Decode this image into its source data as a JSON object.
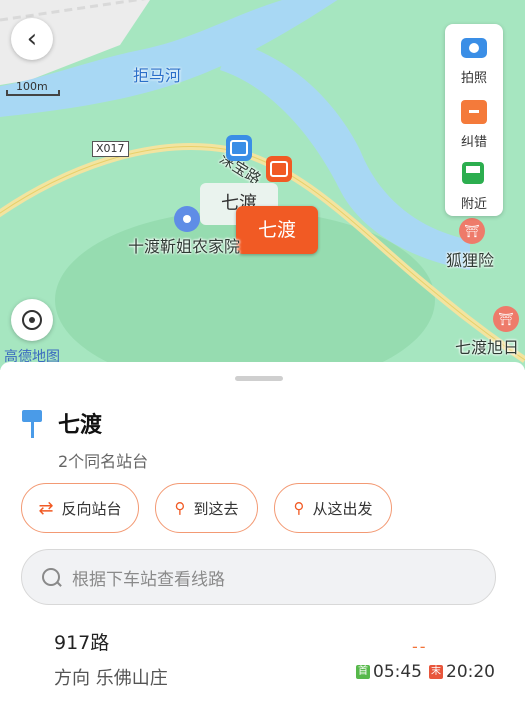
{
  "map": {
    "river_label": "拒马河",
    "scale_label": "100m",
    "road_code": "X017",
    "road_name": "涞宝路",
    "gray_bubble": "七渡",
    "orange_bubble": "七渡",
    "poi_farmhouse": "十渡靳姐农家院",
    "poi_fox": "狐狸险",
    "poi_qidu": "七渡旭日",
    "logo": "高德地图",
    "tools": [
      {
        "label": "拍照",
        "icon": "camera-icon"
      },
      {
        "label": "纠错",
        "icon": "report-error-icon"
      },
      {
        "label": "附近",
        "icon": "nearby-bus-icon"
      }
    ]
  },
  "stop": {
    "name": "七渡",
    "subtitle": "2个同名站台",
    "actions": [
      "反向站台",
      "到这去",
      "从这出发"
    ]
  },
  "search": {
    "placeholder": "根据下车站查看线路"
  },
  "line": {
    "name": "917路",
    "direction": "方向 乐佛山庄",
    "realtime": "--",
    "first_tag": "首",
    "first_time": "05:45",
    "last_tag": "末",
    "last_time": "20:20"
  },
  "colors": {
    "accent": "#f15a24",
    "blue": "#3a8ee6",
    "green": "#2cae4f"
  }
}
